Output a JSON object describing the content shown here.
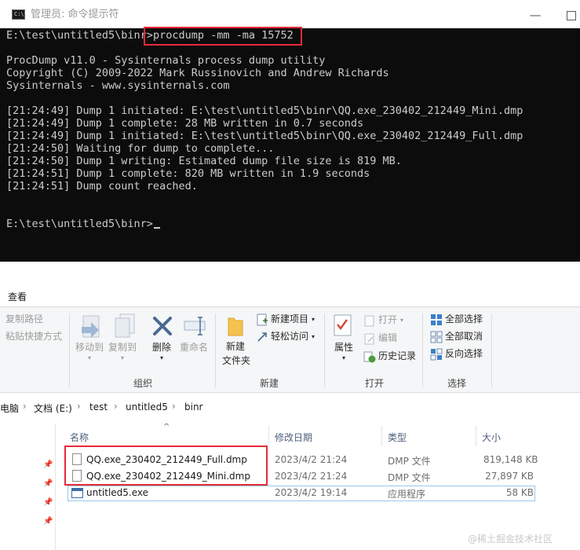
{
  "console": {
    "title": "管理员: 命令提示符",
    "icon_text": "C:\\.",
    "prompt": "E:\\test\\untitled5\\binr>",
    "command": "procdump -mm -ma 15752",
    "banner": [
      "ProcDump v11.0 - Sysinternals process dump utility",
      "Copyright (C) 2009-2022 Mark Russinovich and Andrew Richards",
      "Sysinternals - www.sysinternals.com"
    ],
    "log": [
      "[21:24:49] Dump 1 initiated: E:\\test\\untitled5\\binr\\QQ.exe_230402_212449_Mini.dmp",
      "[21:24:49] Dump 1 complete: 28 MB written in 0.7 seconds",
      "[21:24:49] Dump 1 initiated: E:\\test\\untitled5\\binr\\QQ.exe_230402_212449_Full.dmp",
      "[21:24:50] Waiting for dump to complete...",
      "[21:24:50] Dump 1 writing: Estimated dump file size is 819 MB.",
      "[21:24:51] Dump 1 complete: 820 MB written in 1.9 seconds",
      "[21:24:51] Dump count reached."
    ],
    "final_prompt": "E:\\test\\untitled5\\binr>"
  },
  "ribbon": {
    "tab_view": "查看",
    "clipboard": {
      "copy_path": "复制路径",
      "paste_shortcut": "粘贴快捷方式"
    },
    "organize": {
      "move_to": "移动到",
      "copy_to": "复制到",
      "delete": "删除",
      "rename": "重命名",
      "label": "组织"
    },
    "new": {
      "new_folder_line1": "新建",
      "new_folder_line2": "文件夹",
      "new_item": "新建项目",
      "easy_access": "轻松访问",
      "label": "新建"
    },
    "open": {
      "properties": "属性",
      "open": "打开",
      "edit": "编辑",
      "history": "历史记录",
      "label": "打开"
    },
    "select": {
      "select_all": "全部选择",
      "select_none": "全部取消",
      "invert": "反向选择",
      "label": "选择"
    }
  },
  "address": {
    "crumbs": [
      "电脑",
      "文档 (E:)",
      "test",
      "untitled5",
      "binr"
    ]
  },
  "columns": {
    "name": "名称",
    "modified": "修改日期",
    "type": "类型",
    "size": "大小"
  },
  "files": [
    {
      "name": "QQ.exe_230402_212449_Full.dmp",
      "modified": "2023/4/2 21:24",
      "type": "DMP 文件",
      "size": "819,148 KB"
    },
    {
      "name": "QQ.exe_230402_212449_Mini.dmp",
      "modified": "2023/4/2 21:24",
      "type": "DMP 文件",
      "size": "27,897 KB"
    },
    {
      "name": "untitled5.exe",
      "modified": "2023/4/2 19:14",
      "type": "应用程序",
      "size": "58 KB"
    }
  ],
  "watermark": "@稀土掘金技术社区",
  "colors": {
    "highlight": "#e8293b",
    "console_bg": "#0c0c0c",
    "console_fg": "#cccccc"
  }
}
